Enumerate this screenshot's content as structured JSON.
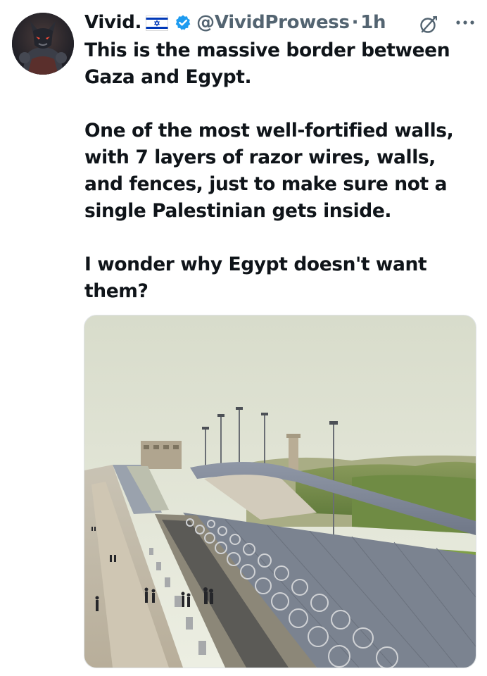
{
  "tweet": {
    "display_name": "Vivid.",
    "handle": "@VividProwess",
    "separator": "·",
    "time": "1h",
    "paragraphs": [
      "This is the massive border between Gaza and Egypt.",
      "One of the most well-fortified walls, with 7 layers of razor wires, walls, and fences, just to make sure not a single Palestinian gets inside.",
      "I wonder why Egypt doesn't want them?"
    ]
  },
  "icons": {
    "flag": "israel-flag-icon",
    "verified": "verified-badge-icon",
    "grok": "grok-icon",
    "more": "more-options-icon"
  },
  "colors": {
    "text": "#0f1419",
    "secondary": "#536471",
    "verified_blue": "#1d9bf0",
    "flag_blue": "#0038b8"
  }
}
